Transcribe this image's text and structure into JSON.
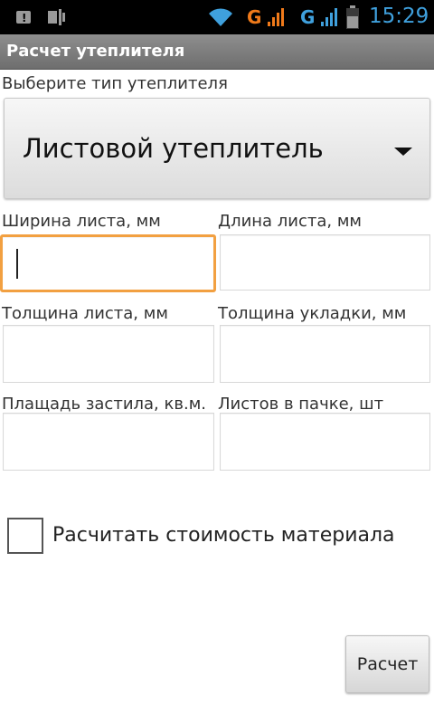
{
  "status_bar": {
    "time": "15:29",
    "network_label_1": "G",
    "network_label_2": "G",
    "network_color_1": "#f07a1a",
    "network_color_2": "#3fa0dd",
    "icons": [
      "notification-alert-icon",
      "usb-debug-icon",
      "wifi-icon",
      "signal-icon",
      "signal-icon",
      "battery-icon"
    ]
  },
  "title_bar": {
    "title": "Расчет утеплителя"
  },
  "form": {
    "type_label": "Выберите тип утеплителя",
    "type_selected": "Листовой утеплитель",
    "fields": [
      {
        "label": "Ширина листа, мм",
        "value": ""
      },
      {
        "label": "Длина листа, мм",
        "value": ""
      },
      {
        "label": "Толщина листа, мм",
        "value": ""
      },
      {
        "label": "Толщина укладки, мм",
        "value": ""
      },
      {
        "label": "Плащадь застила, кв.м.",
        "value": ""
      },
      {
        "label": "Листов в пачке, шт",
        "value": ""
      }
    ],
    "checkbox_label": "Расчитать стоимость материала",
    "checkbox_checked": false,
    "calculate_button": "Расчет"
  },
  "colors": {
    "focus_accent": "#f2a041",
    "title_bar": "#7e7e7e"
  }
}
